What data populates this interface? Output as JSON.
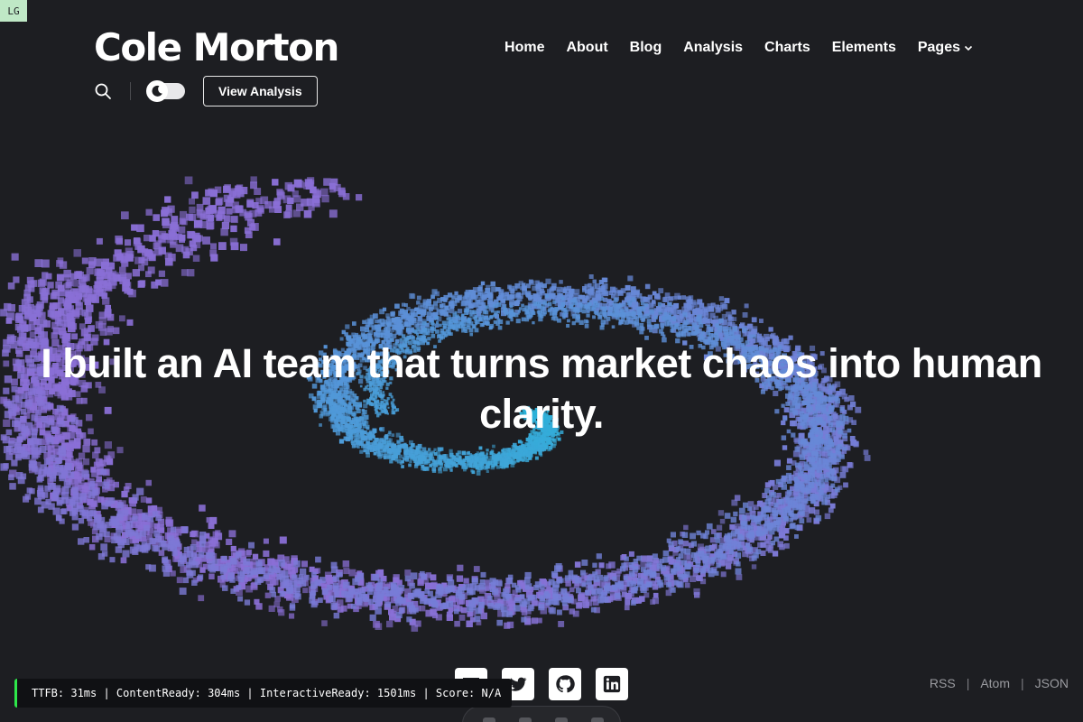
{
  "breakpoint_badge": "LG",
  "logo": "Cole Morton",
  "nav": [
    {
      "label": "Home"
    },
    {
      "label": "About"
    },
    {
      "label": "Blog"
    },
    {
      "label": "Analysis"
    },
    {
      "label": "Charts"
    },
    {
      "label": "Elements"
    },
    {
      "label": "Pages",
      "has_dropdown": true
    }
  ],
  "tools": {
    "search_icon": "search-icon",
    "theme_toggle_icon": "moon-icon",
    "cta_label": "View Analysis"
  },
  "hero": {
    "title": "I built an AI team that turns market chaos into human clarity."
  },
  "social": [
    {
      "icon": "menu-icon"
    },
    {
      "icon": "twitter-icon"
    },
    {
      "icon": "github-icon"
    },
    {
      "icon": "linkedin-icon"
    }
  ],
  "feeds": {
    "rss": "RSS",
    "atom": "Atom",
    "json": "JSON",
    "separator": "|"
  },
  "perf_bar": "TTFB: 31ms | ContentReady: 304ms | InteractiveReady: 1501ms | Score: N/A",
  "colors": {
    "background": "#1d1e22",
    "particle_cyan": "#2bb3d9",
    "particle_purple": "#8a6fd6",
    "perf_accent": "#2ee84a"
  }
}
